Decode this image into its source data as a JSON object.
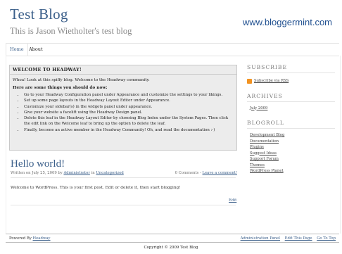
{
  "header": {
    "title": "Test Blog",
    "tagline": "This is Jason Wietholter's test blog"
  },
  "watermark": "www.bloggermint.com",
  "nav": {
    "items": [
      {
        "label": "Home",
        "active": true
      },
      {
        "label": "About",
        "active": false
      }
    ]
  },
  "welcome": {
    "title": "WELCOME TO HEADWAY!",
    "intro": "Whoa! Look at this spiffy blog. Welcome to the Headway community.",
    "subtitle": "Here are some things you should do now:",
    "items": [
      "Go to your Headway Configuration panel under Appearance and customize the settings to your likings.",
      "Set up some page layouts in the Headway Layout Editor under Appearance.",
      "Customize your sidebar(s) in the widgets panel under appearance.",
      "Give your website a facelift using the Headway Design panel.",
      "Delete this leaf in the Headway Layout Editor by choosing Blog Index under the System Pages. Then click the edit link on the Welcome leaf to bring up the option to delete the leaf.",
      "Finally, become an active member in the Headway Community! Oh, and read the documentation :-)"
    ]
  },
  "post": {
    "title": "Hello world!",
    "meta_prefix": "Written on July 25, 2009 by",
    "author": "Administrator",
    "meta_in": "in",
    "category": "Uncategorized",
    "comments": "0 Comments",
    "comments_sep": "-",
    "leave_comment": "Leave a comment!",
    "body": "Welcome to WordPress. This is your first post. Edit or delete it, then start blogging!",
    "edit_label": "Edit"
  },
  "sidebar": {
    "subscribe": {
      "heading": "SUBSCRIBE",
      "rss_label": "Subscribe via RSS"
    },
    "archives": {
      "heading": "ARCHIVES",
      "items": [
        "July 2009"
      ]
    },
    "blogroll": {
      "heading": "BLOGROLL",
      "items": [
        "Development Blog",
        "Documentation",
        "Plugins",
        "Suggest Ideas",
        "Support Forum",
        "Themes",
        "WordPress Planet"
      ]
    }
  },
  "footer": {
    "powered_prefix": "Powered By",
    "powered_link": "Headway",
    "links": [
      "Administration Panel",
      "Edit This Page",
      "Go To Top"
    ],
    "copyright": "Copyright © 2009 Test Blog"
  },
  "colors": {
    "accent": "#3b5f8a",
    "rss": "#f29322"
  }
}
